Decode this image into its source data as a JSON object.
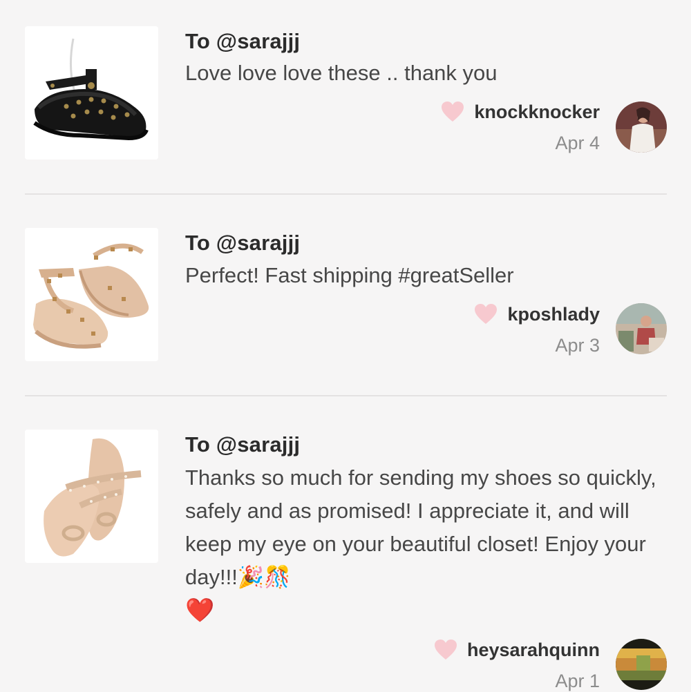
{
  "reviews": [
    {
      "to": "To @sarajjj",
      "message": "Love love love these .. thank you",
      "username": "knockknocker",
      "date": "Apr 4",
      "product_icon": "black-studded-jelly-sandal-icon",
      "avatar_icon": "user-avatar-icon"
    },
    {
      "to": "To @sarajjj",
      "message": "Perfect! Fast shipping #greatSeller",
      "username": "kposhlady",
      "date": "Apr 3",
      "product_icon": "rose-gold-studded-sandal-icon",
      "avatar_icon": "user-avatar-icon"
    },
    {
      "to": "To @sarajjj",
      "message": "Thanks so much for sending my shoes so quickly, safely and as promised! I appreciate it, and will keep my eye on your beautiful closet! Enjoy your day!!!🎉🎊",
      "message_emoji": "❤️",
      "username": "heysarahquinn",
      "date": "Apr 1",
      "product_icon": "nude-toe-ring-slide-sandal-icon",
      "avatar_icon": "user-avatar-icon"
    }
  ],
  "colors": {
    "background": "#f6f5f5",
    "like_heart": "#f7c9cf",
    "emoji_heart": "#e0182f",
    "divider": "#e4e2e2"
  }
}
